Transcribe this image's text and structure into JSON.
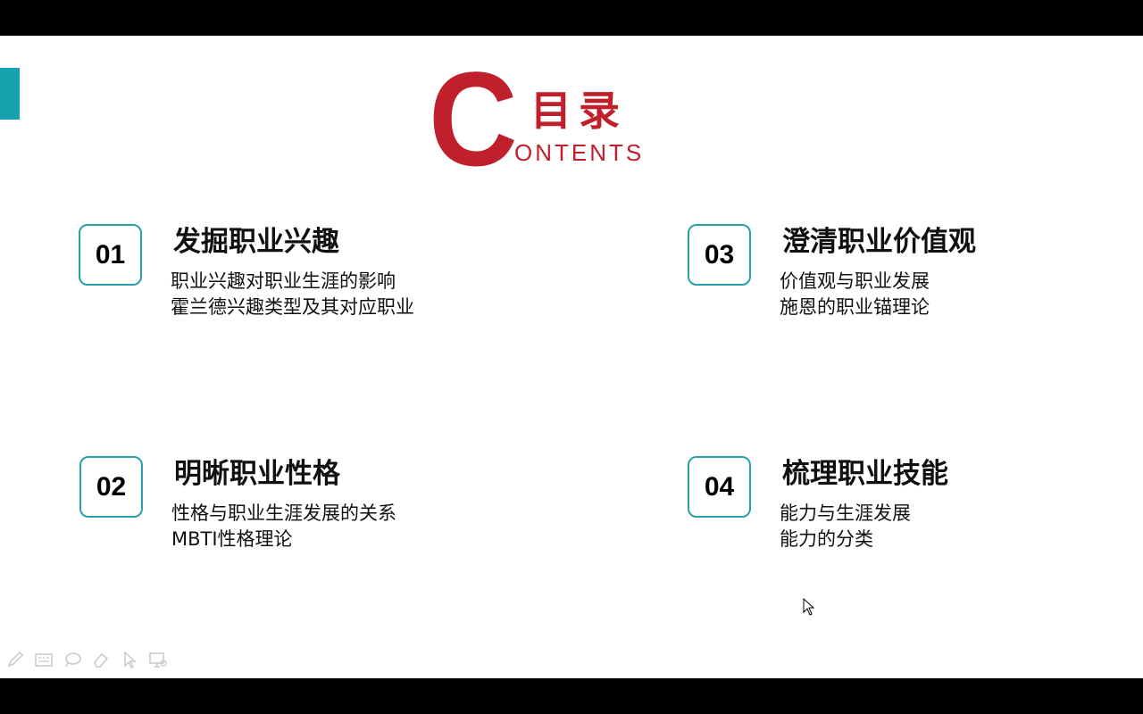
{
  "title": {
    "letter": "C",
    "chinese": "目录",
    "english_rest": "ONTENTS"
  },
  "sections": [
    {
      "number": "01",
      "title": "发掘职业兴趣",
      "items": [
        "职业兴趣对职业生涯的影响",
        "霍兰德兴趣类型及其对应职业"
      ]
    },
    {
      "number": "02",
      "title": "明晰职业性格",
      "items": [
        "性格与职业生涯发展的关系",
        "MBTI性格理论"
      ]
    },
    {
      "number": "03",
      "title": "澄清职业价值观",
      "items": [
        "价值观与职业发展",
        "施恩的职业锚理论"
      ]
    },
    {
      "number": "04",
      "title": "梳理职业技能",
      "items": [
        "能力与生涯发展",
        "能力的分类"
      ]
    }
  ],
  "toolbar": {
    "icons": [
      "pen-icon",
      "keyboard-icon",
      "lasso-icon",
      "eraser-icon",
      "pointer-icon",
      "screen-icon"
    ]
  },
  "colors": {
    "accent_red": "#c0202b",
    "accent_teal": "#17a2b0",
    "box_border": "#2aa0aa"
  }
}
